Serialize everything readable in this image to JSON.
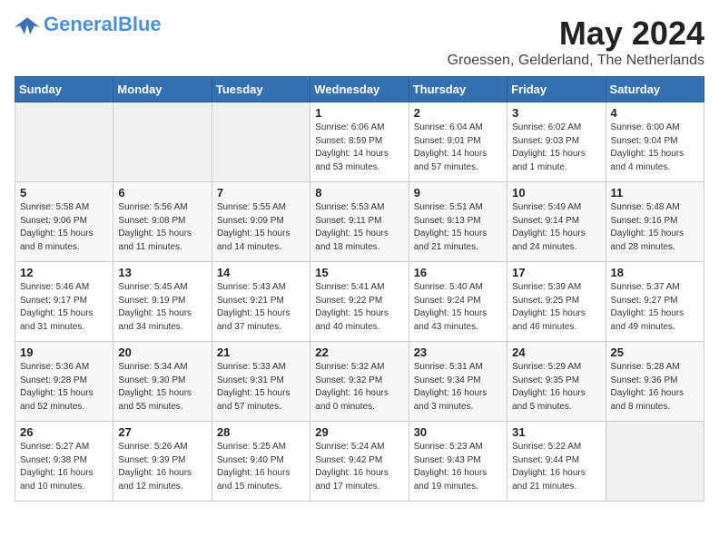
{
  "header": {
    "logo": {
      "line1a": "General",
      "line1b": "Blue",
      "tagline": ""
    },
    "title": "May 2024",
    "subtitle": "Groessen, Gelderland, The Netherlands"
  },
  "weekdays": [
    "Sunday",
    "Monday",
    "Tuesday",
    "Wednesday",
    "Thursday",
    "Friday",
    "Saturday"
  ],
  "weeks": [
    [
      {
        "day": "",
        "info": ""
      },
      {
        "day": "",
        "info": ""
      },
      {
        "day": "",
        "info": ""
      },
      {
        "day": "1",
        "info": "Sunrise: 6:06 AM\nSunset: 8:59 PM\nDaylight: 14 hours\nand 53 minutes."
      },
      {
        "day": "2",
        "info": "Sunrise: 6:04 AM\nSunset: 9:01 PM\nDaylight: 14 hours\nand 57 minutes."
      },
      {
        "day": "3",
        "info": "Sunrise: 6:02 AM\nSunset: 9:03 PM\nDaylight: 15 hours\nand 1 minute."
      },
      {
        "day": "4",
        "info": "Sunrise: 6:00 AM\nSunset: 9:04 PM\nDaylight: 15 hours\nand 4 minutes."
      }
    ],
    [
      {
        "day": "5",
        "info": "Sunrise: 5:58 AM\nSunset: 9:06 PM\nDaylight: 15 hours\nand 8 minutes."
      },
      {
        "day": "6",
        "info": "Sunrise: 5:56 AM\nSunset: 9:08 PM\nDaylight: 15 hours\nand 11 minutes."
      },
      {
        "day": "7",
        "info": "Sunrise: 5:55 AM\nSunset: 9:09 PM\nDaylight: 15 hours\nand 14 minutes."
      },
      {
        "day": "8",
        "info": "Sunrise: 5:53 AM\nSunset: 9:11 PM\nDaylight: 15 hours\nand 18 minutes."
      },
      {
        "day": "9",
        "info": "Sunrise: 5:51 AM\nSunset: 9:13 PM\nDaylight: 15 hours\nand 21 minutes."
      },
      {
        "day": "10",
        "info": "Sunrise: 5:49 AM\nSunset: 9:14 PM\nDaylight: 15 hours\nand 24 minutes."
      },
      {
        "day": "11",
        "info": "Sunrise: 5:48 AM\nSunset: 9:16 PM\nDaylight: 15 hours\nand 28 minutes."
      }
    ],
    [
      {
        "day": "12",
        "info": "Sunrise: 5:46 AM\nSunset: 9:17 PM\nDaylight: 15 hours\nand 31 minutes."
      },
      {
        "day": "13",
        "info": "Sunrise: 5:45 AM\nSunset: 9:19 PM\nDaylight: 15 hours\nand 34 minutes."
      },
      {
        "day": "14",
        "info": "Sunrise: 5:43 AM\nSunset: 9:21 PM\nDaylight: 15 hours\nand 37 minutes."
      },
      {
        "day": "15",
        "info": "Sunrise: 5:41 AM\nSunset: 9:22 PM\nDaylight: 15 hours\nand 40 minutes."
      },
      {
        "day": "16",
        "info": "Sunrise: 5:40 AM\nSunset: 9:24 PM\nDaylight: 15 hours\nand 43 minutes."
      },
      {
        "day": "17",
        "info": "Sunrise: 5:39 AM\nSunset: 9:25 PM\nDaylight: 15 hours\nand 46 minutes."
      },
      {
        "day": "18",
        "info": "Sunrise: 5:37 AM\nSunset: 9:27 PM\nDaylight: 15 hours\nand 49 minutes."
      }
    ],
    [
      {
        "day": "19",
        "info": "Sunrise: 5:36 AM\nSunset: 9:28 PM\nDaylight: 15 hours\nand 52 minutes."
      },
      {
        "day": "20",
        "info": "Sunrise: 5:34 AM\nSunset: 9:30 PM\nDaylight: 15 hours\nand 55 minutes."
      },
      {
        "day": "21",
        "info": "Sunrise: 5:33 AM\nSunset: 9:31 PM\nDaylight: 15 hours\nand 57 minutes."
      },
      {
        "day": "22",
        "info": "Sunrise: 5:32 AM\nSunset: 9:32 PM\nDaylight: 16 hours\nand 0 minutes."
      },
      {
        "day": "23",
        "info": "Sunrise: 5:31 AM\nSunset: 9:34 PM\nDaylight: 16 hours\nand 3 minutes."
      },
      {
        "day": "24",
        "info": "Sunrise: 5:29 AM\nSunset: 9:35 PM\nDaylight: 16 hours\nand 5 minutes."
      },
      {
        "day": "25",
        "info": "Sunrise: 5:28 AM\nSunset: 9:36 PM\nDaylight: 16 hours\nand 8 minutes."
      }
    ],
    [
      {
        "day": "26",
        "info": "Sunrise: 5:27 AM\nSunset: 9:38 PM\nDaylight: 16 hours\nand 10 minutes."
      },
      {
        "day": "27",
        "info": "Sunrise: 5:26 AM\nSunset: 9:39 PM\nDaylight: 16 hours\nand 12 minutes."
      },
      {
        "day": "28",
        "info": "Sunrise: 5:25 AM\nSunset: 9:40 PM\nDaylight: 16 hours\nand 15 minutes."
      },
      {
        "day": "29",
        "info": "Sunrise: 5:24 AM\nSunset: 9:42 PM\nDaylight: 16 hours\nand 17 minutes."
      },
      {
        "day": "30",
        "info": "Sunrise: 5:23 AM\nSunset: 9:43 PM\nDaylight: 16 hours\nand 19 minutes."
      },
      {
        "day": "31",
        "info": "Sunrise: 5:22 AM\nSunset: 9:44 PM\nDaylight: 16 hours\nand 21 minutes."
      },
      {
        "day": "",
        "info": ""
      }
    ]
  ]
}
